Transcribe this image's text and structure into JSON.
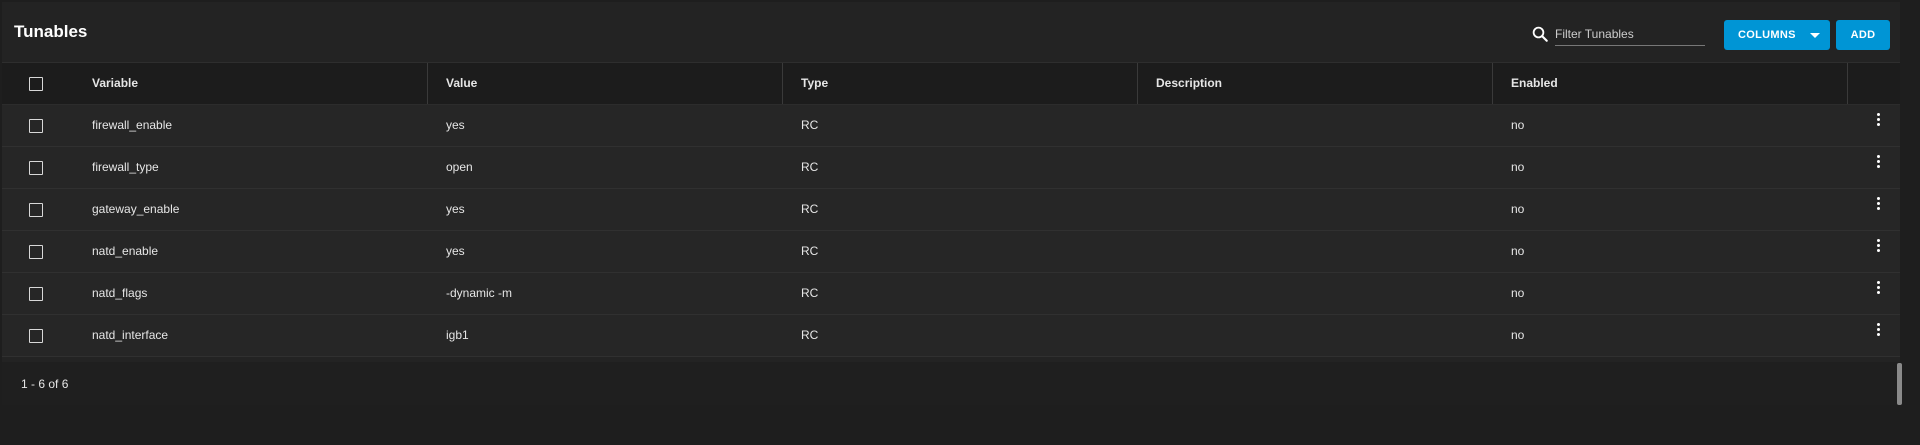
{
  "header": {
    "title": "Tunables",
    "search_placeholder": "Filter Tunables",
    "columns_label": "COLUMNS",
    "add_label": "ADD"
  },
  "table": {
    "columns": [
      "Variable",
      "Value",
      "Type",
      "Description",
      "Enabled"
    ],
    "rows": [
      {
        "variable": "firewall_enable",
        "value": "yes",
        "type": "RC",
        "description": "",
        "enabled": "no"
      },
      {
        "variable": "firewall_type",
        "value": "open",
        "type": "RC",
        "description": "",
        "enabled": "no"
      },
      {
        "variable": "gateway_enable",
        "value": "yes",
        "type": "RC",
        "description": "",
        "enabled": "no"
      },
      {
        "variable": "natd_enable",
        "value": "yes",
        "type": "RC",
        "description": "",
        "enabled": "no"
      },
      {
        "variable": "natd_flags",
        "value": "-dynamic -m",
        "type": "RC",
        "description": "",
        "enabled": "no"
      },
      {
        "variable": "natd_interface",
        "value": "igb1",
        "type": "RC",
        "description": "",
        "enabled": "no"
      }
    ]
  },
  "footer": {
    "pagination": "1 - 6 of 6"
  },
  "colors": {
    "accent": "#0095d5",
    "background": "#1e1e1e",
    "panel": "#232323"
  },
  "icons": {
    "search": "search-icon",
    "caret": "chevron-down-icon",
    "row_menu": "more-vert-icon"
  }
}
